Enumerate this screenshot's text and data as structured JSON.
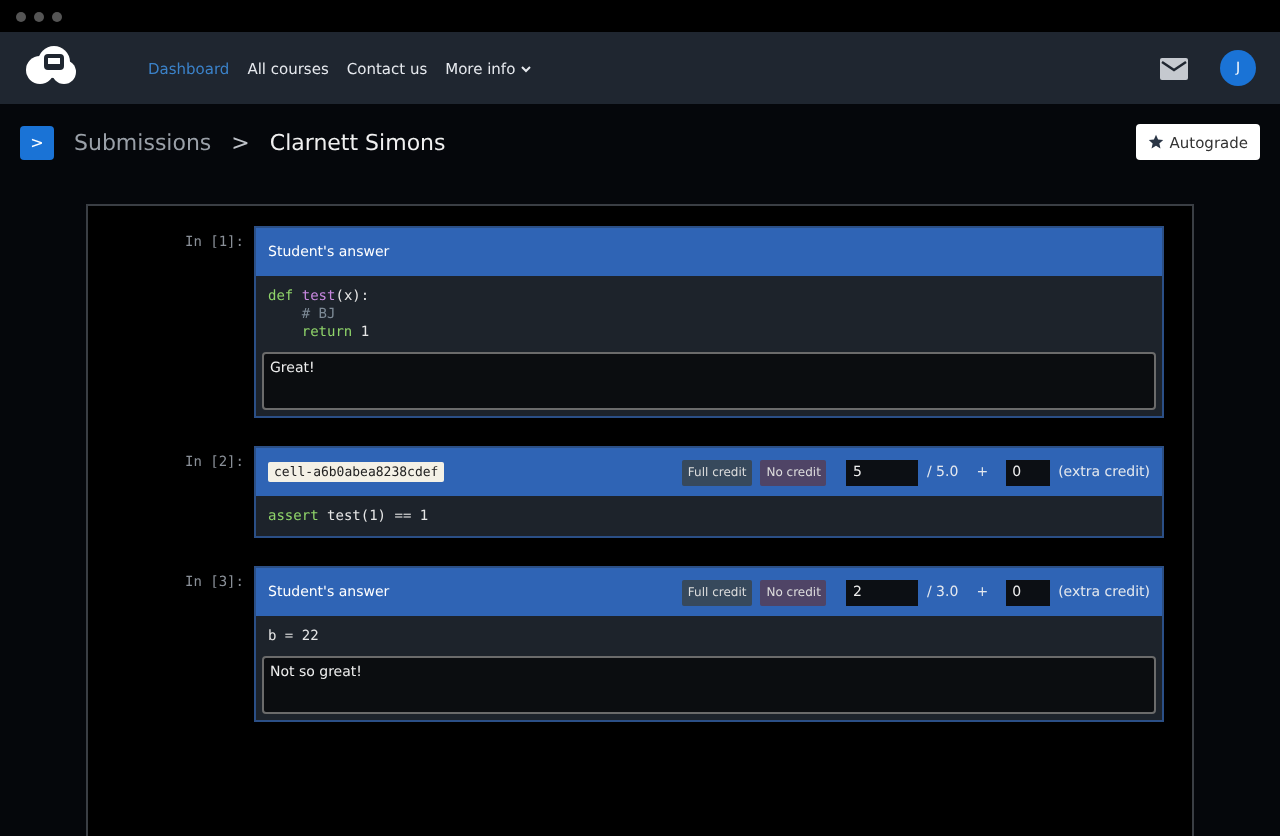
{
  "nav": {
    "items": [
      {
        "label": "Dashboard",
        "selected": true
      },
      {
        "label": "All courses",
        "selected": false
      },
      {
        "label": "Contact us",
        "selected": false
      },
      {
        "label": "More info",
        "selected": false,
        "dropdown": true
      }
    ],
    "avatar": "J"
  },
  "breadcrumb": {
    "toggle": ">",
    "items": [
      "Submissions",
      "Clarnett Simons"
    ],
    "separator": ">",
    "action": "Autograde"
  },
  "cells": [
    {
      "prompt": "In [1]:",
      "header": {
        "kind": "title",
        "text": "Student's answer"
      },
      "code": [
        [
          {
            "text": "def",
            "kind": "keyword"
          },
          {
            "text": " test",
            "kind": "function"
          },
          {
            "text": "(x):",
            "kind": "plain"
          }
        ],
        [
          {
            "text": "    # BJ",
            "kind": "comment"
          }
        ],
        [
          {
            "text": "    return",
            "kind": "keyword"
          },
          {
            "text": " 1",
            "kind": "plain"
          }
        ]
      ],
      "comment": "Great!"
    },
    {
      "prompt": "In [2]:",
      "header": {
        "kind": "id",
        "text": "cell-a6b0abea8238cdef"
      },
      "grading": {
        "full": "Full credit",
        "none": "No credit",
        "score": "5",
        "max": "/ 5.0",
        "plus": "+",
        "extra": "0",
        "extra_label": "(extra credit)"
      },
      "code": [
        [
          {
            "text": "assert",
            "kind": "keyword"
          },
          {
            "text": " test(1) == 1",
            "kind": "plain"
          }
        ]
      ]
    },
    {
      "prompt": "In [3]:",
      "header": {
        "kind": "title",
        "text": "Student's answer"
      },
      "grading": {
        "full": "Full credit",
        "none": "No credit",
        "score": "2",
        "max": "/ 3.0",
        "plus": "+",
        "extra": "0",
        "extra_label": "(extra credit)"
      },
      "code": [
        [
          {
            "text": "b = 22",
            "kind": "plain"
          }
        ]
      ],
      "comment": "Not so great!"
    }
  ]
}
